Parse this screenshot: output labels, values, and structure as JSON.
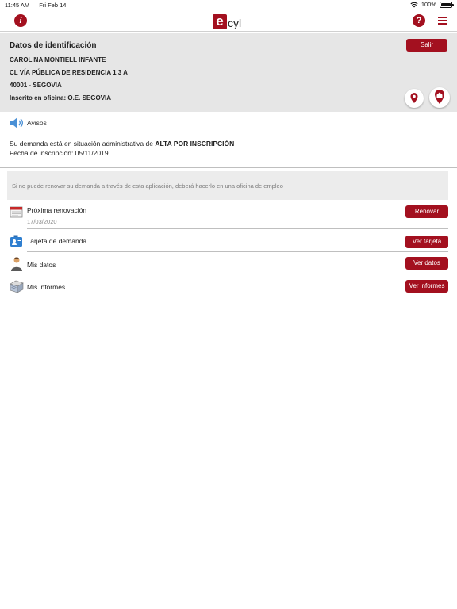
{
  "status_bar": {
    "time": "11:45 AM",
    "date": "Fri Feb 14",
    "battery": "100%"
  },
  "nav": {
    "info_icon": "info-icon",
    "logo_e": "e",
    "logo_text": "cyl",
    "help_icon": "question-icon",
    "menu_icon": "hamburger-icon"
  },
  "identification": {
    "title": "Datos de identificación",
    "name": "CAROLINA MONTIELL INFANTE",
    "address": "CL VÍA PÚBLICA DE RESIDENCIA 1 3 A",
    "city": "40001 - SEGOVIA",
    "office": "Inscrito en oficina: O.E. SEGOVIA",
    "salir_label": "Salir"
  },
  "avisos": {
    "label": "Avisos"
  },
  "demand_status": {
    "prefix": "Su demanda está en situación administrativa de ",
    "status": "ALTA POR INSCRIPCIÓN",
    "date_line": "Fecha de inscripción: 05/11/2019"
  },
  "notice_text": "Si no puede renovar su demanda a través de esta aplicación, deberá hacerlo en una oficina de empleo",
  "items": [
    {
      "title": "Próxima renovación",
      "subtitle": "17/03/2020",
      "button": "Renovar",
      "icon": "calendar-icon"
    },
    {
      "title": "Tarjeta de demanda",
      "button": "Ver tarjeta",
      "icon": "id-card-icon"
    },
    {
      "title": "Mis datos",
      "button": "Ver datos",
      "icon": "person-icon"
    },
    {
      "title": "Mis informes",
      "button": "Ver informes",
      "icon": "documents-icon"
    }
  ],
  "colors": {
    "accent": "#a3101f",
    "panel": "#e6e6e6",
    "notice": "#ececec"
  }
}
